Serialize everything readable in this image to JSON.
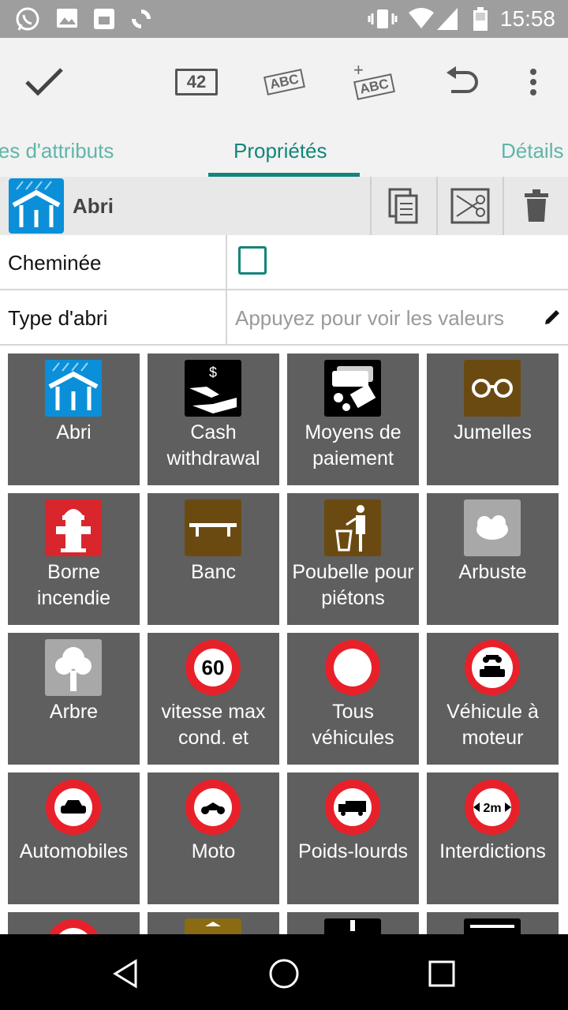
{
  "status_bar": {
    "time": "15:58"
  },
  "toolbar": {
    "counter_label": "42",
    "abc_label": "ABC",
    "abc_add_label": "ABC"
  },
  "tabs": [
    {
      "label": "les d'attributs"
    },
    {
      "label": "Propriétés"
    },
    {
      "label": "Détails"
    }
  ],
  "preset": {
    "name": "Abri"
  },
  "fields": {
    "chimney": {
      "label": "Cheminée",
      "checked": false
    },
    "shelter_type": {
      "label": "Type d'abri",
      "placeholder": "Appuyez pour voir les valeurs"
    }
  },
  "tiles": [
    {
      "label": "Abri"
    },
    {
      "label": "Cash withdrawal",
      "icon_text": "$"
    },
    {
      "label": "Moyens de paiement"
    },
    {
      "label": "Jumelles"
    },
    {
      "label": "Borne incendie"
    },
    {
      "label": "Banc"
    },
    {
      "label": "Poubelle pour piétons"
    },
    {
      "label": "Arbuste"
    },
    {
      "label": "Arbre"
    },
    {
      "label": "vitesse max cond. et",
      "icon_text": "60"
    },
    {
      "label": "Tous véhicules"
    },
    {
      "label": "Véhicule à moteur"
    },
    {
      "label": "Automobiles"
    },
    {
      "label": "Moto"
    },
    {
      "label": "Poids-lourds"
    },
    {
      "label": "Interdictions",
      "icon_text": "2m"
    }
  ],
  "colors": {
    "accent": "#13857a",
    "tile_bg": "#5f5f5f",
    "status_bar": "#9e9e9e",
    "prohibition_red": "#e8202a",
    "blue_icon": "#0b8fd9",
    "brown_icon": "#6b4a12"
  }
}
